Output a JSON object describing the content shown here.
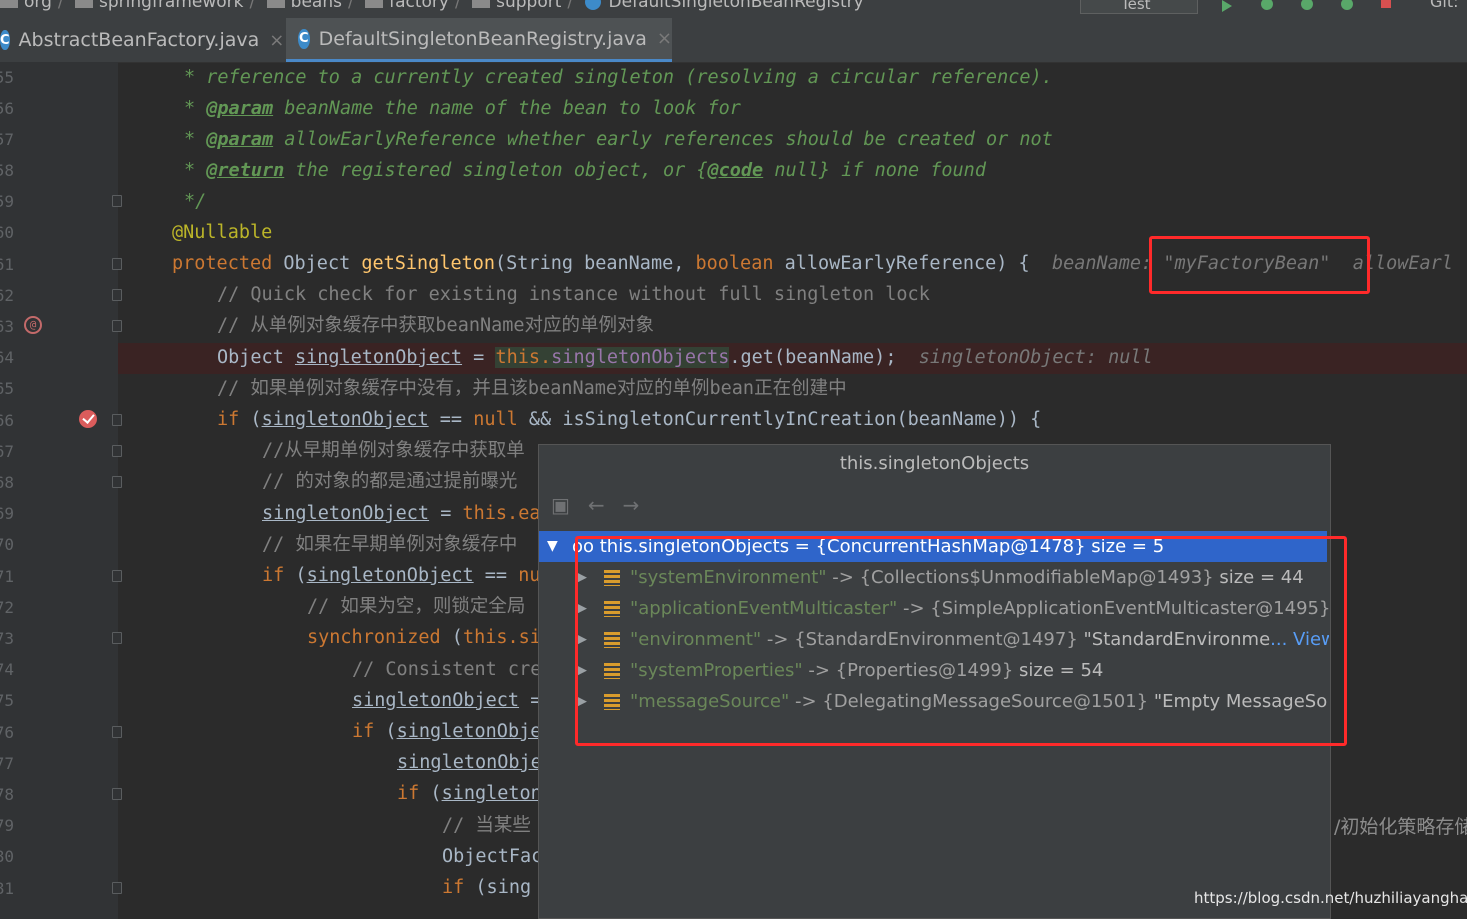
{
  "breadcrumb": [
    "org",
    "springframework",
    "beans",
    "factory",
    "support",
    "DefaultSingletonBeanRegistry"
  ],
  "run_config": "Test",
  "vcs_label": "Git:",
  "tabs": [
    {
      "label": "AbstractBeanFactory.java",
      "icon": "class-icon"
    },
    {
      "label": "DefaultSingletonBeanRegistry.java",
      "icon": "class-icon",
      "active": true
    }
  ],
  "line_numbers": [
    "55",
    "56",
    "57",
    "58",
    "59",
    "60",
    "61",
    "62",
    "63",
    "64",
    "65",
    "66",
    "67",
    "68",
    "69",
    "70",
    "71",
    "72",
    "73",
    "74",
    "75",
    "76",
    "77",
    "78",
    "79",
    "80",
    "81"
  ],
  "code": {
    "l55": "* reference to a currently created singleton (resolving a circular reference).",
    "l56_tag": "@param",
    "l56_a": "beanName",
    "l56_b": " the name of the bean to look for",
    "l57_tag": "@param",
    "l57_a": "allowEarlyReference",
    "l57_b": " whether early references should be created or not",
    "l58_tag": "@return",
    "l58_b": " the registered singleton object, or {",
    "l58_code": "@code",
    "l58_c": " null} if none found",
    "l59": "*/",
    "l60": "@Nullable",
    "l61_kw": "protected",
    "l61_type": " Object ",
    "l61_fn": "getSingleton",
    "l61_p1": "(String beanName, ",
    "l61_kw2": "boolean",
    "l61_p2": " allowEarlyReference) {",
    "l61_hint_name": "beanName:",
    "l61_hint_val": "\"myFactoryBean\"",
    "l61_hint_more": "allowEarl",
    "l62": "// Quick check for existing instance without full singleton lock",
    "l63": "// 从单例对象缓存中获取beanName对应的单例对象",
    "l64_a": "Object ",
    "l64_var": "singletonObject",
    "l64_b": " = ",
    "l64_this": "this.",
    "l64_fld": "singletonObjects",
    "l64_c": ".get(beanName);",
    "l64_hint": "singletonObject: null",
    "l65": "// 如果单例对象缓存中没有，并且该beanName对应的单例bean正在创建中",
    "l66_kw": "if",
    "l66_a": " (",
    "l66_var": "singletonObject",
    "l66_b": " == ",
    "l66_null": "null",
    "l66_c": " && isSingletonCurrentlyInCreation(beanName)) {",
    "l67": "//从早期单例对象缓存中获取单",
    "l68": "// 的对象的都是通过提前曝光",
    "l69_var": "singletonObject",
    "l69_b": " = ",
    "l69_this": "this.ea",
    "l70": "// 如果在早期单例对象缓存中",
    "l71_kw": "if",
    "l71_a": " (",
    "l71_var": "singletonObject",
    "l71_b": " == ",
    "l71_null": "nu",
    "l72": "// 如果为空，则锁定全局",
    "l73_kw": "synchronized",
    "l73_a": " (",
    "l73_this": "this.si",
    "l74": "// Consistent cre",
    "l75_var": "singletonObject",
    "l75_b": " =",
    "l76_kw": "if",
    "l76_a": " (",
    "l76_var": "singletonObje",
    "l77_var": "singletonObje",
    "l78_kw": "if",
    "l78_a": " (",
    "l78_var": "singleton",
    "l79": "// 当某些",
    "l80": "ObjectFac",
    "l81_kw": "if",
    "l81_a": " (sing"
  },
  "popup": {
    "title": "this.singletonObjects",
    "root": "oo this.singletonObjects = {ConcurrentHashMap@1478}  size = 5",
    "entries": [
      {
        "key": "\"systemEnvironment\"",
        "arrow": " -> ",
        "ref": "{Collections$UnmodifiableMap@1493}",
        "extra": "  size = 44",
        "view": ""
      },
      {
        "key": "\"applicationEventMulticaster\"",
        "arrow": " -> ",
        "ref": "{SimpleApplicationEventMulticaster@1495}",
        "extra": "",
        "view": ""
      },
      {
        "key": "\"environment\"",
        "arrow": " -> ",
        "ref": "{StandardEnvironment@1497}",
        "extra": " \"StandardEnvironme",
        "view": "... View"
      },
      {
        "key": "\"systemProperties\"",
        "arrow": " -> ",
        "ref": "{Properties@1499}",
        "extra": "  size = 54",
        "view": ""
      },
      {
        "key": "\"messageSource\"",
        "arrow": " -> ",
        "ref": "{DelegatingMessageSource@1501}",
        "extra": " \"Empty MessageSo",
        "view": ""
      }
    ]
  },
  "side_text": "/初始化策略存储",
  "watermark": "https://blog.csdn.net/huzhiliayanghao",
  "colors": {
    "keyword": "#cc7832",
    "comment": "#629755",
    "annotation": "#bbb529",
    "function": "#ffc66d",
    "field": "#9876aa",
    "string": "#6a8759",
    "highlight_red": "#ff2a2a"
  }
}
